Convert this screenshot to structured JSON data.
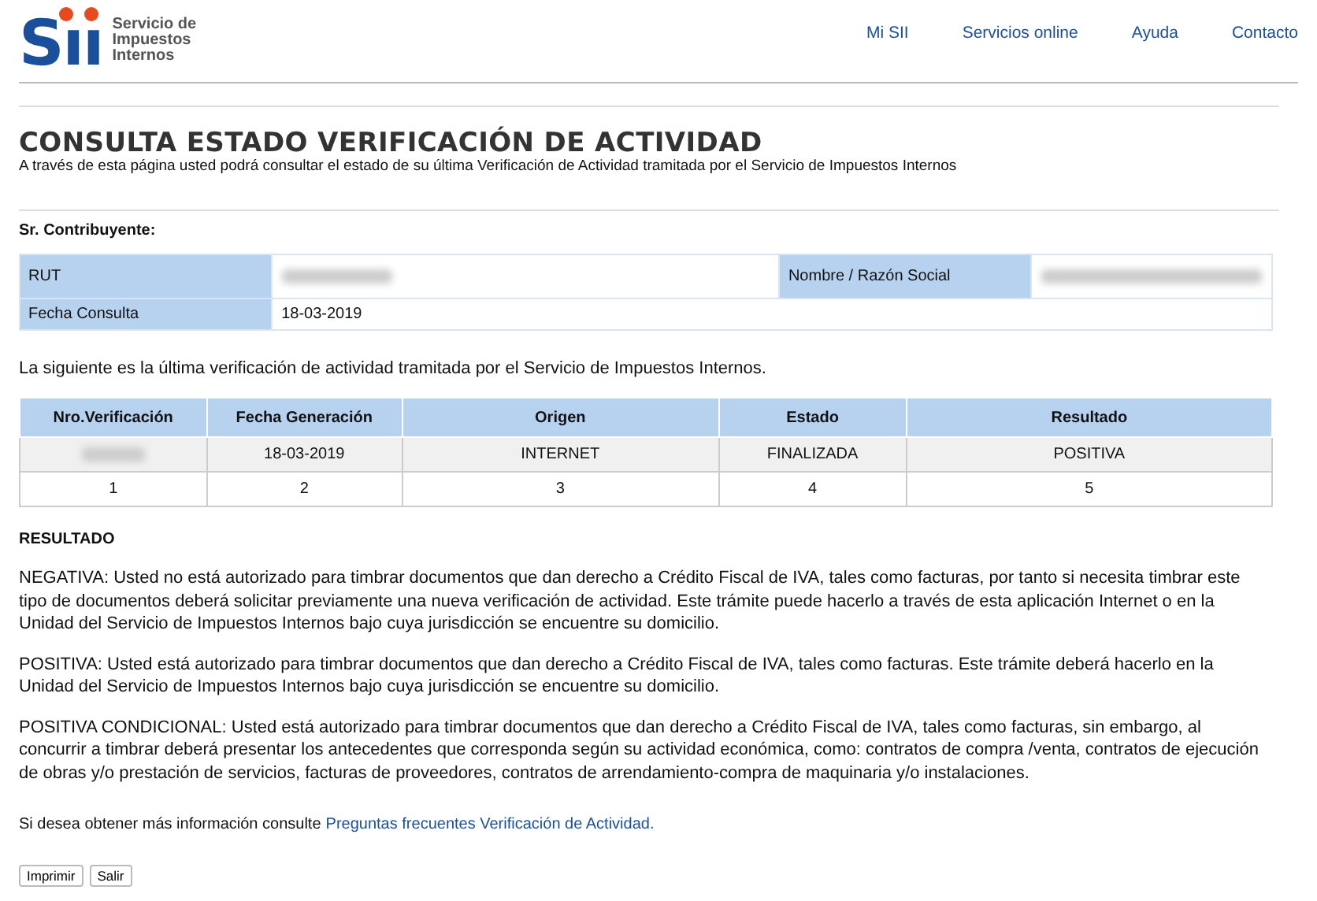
{
  "header": {
    "logo": {
      "mark": "Sıı",
      "name_lines": [
        "Servicio de",
        "Impuestos",
        "Internos"
      ]
    },
    "nav": [
      "Mi SII",
      "Servicios online",
      "Ayuda",
      "Contacto"
    ]
  },
  "title": "CONSULTA ESTADO VERIFICACIÓN DE ACTIVIDAD",
  "subtitle": "A través de esta página usted podrá consultar el estado de su última Verificación de Actividad tramitada por el Servicio de Impuestos Internos",
  "contributor": {
    "heading": "Sr. Contribuyente:",
    "rows": [
      [
        {
          "label": "RUT",
          "redacted": true
        },
        {
          "label": "Nombre / Razón Social",
          "redacted": true
        }
      ],
      [
        {
          "label": "Fecha Consulta",
          "value": "18-03-2019",
          "redacted": false
        }
      ]
    ]
  },
  "intro": "La siguiente es la última verificación de actividad tramitada por el Servicio de Impuestos Internos.",
  "table": {
    "columns": [
      "Nro.Verificación",
      "Fecha Generación",
      "Origen",
      "Estado",
      "Resultado"
    ],
    "rows": [
      [
        {
          "redacted": true
        },
        {
          "value": "18-03-2019",
          "redacted": false
        },
        {
          "value": "INTERNET",
          "redacted": false
        },
        {
          "value": "FINALIZADA",
          "redacted": false
        },
        {
          "value": "POSITIVA",
          "redacted": false
        }
      ],
      [
        {
          "value": "1",
          "redacted": false
        },
        {
          "value": "2",
          "redacted": false
        },
        {
          "value": "3",
          "redacted": false
        },
        {
          "value": "4",
          "redacted": false
        },
        {
          "value": "5",
          "redacted": false
        }
      ]
    ]
  },
  "result": {
    "heading": "RESULTADO",
    "paragraphs": [
      "NEGATIVA: Usted no está autorizado para timbrar documentos que dan derecho a Crédito Fiscal de IVA, tales como facturas, por tanto si necesita timbrar este tipo de documentos deberá solicitar previamente una nueva verificación de actividad. Este trámite puede hacerlo a través de esta aplicación Internet o en la Unidad del Servicio de Impuestos Internos bajo cuya jurisdicción se encuentre su domicilio.",
      "POSITIVA: Usted está autorizado para timbrar documentos que dan derecho a Crédito Fiscal de IVA, tales como facturas. Este trámite deberá hacerlo en la Unidad del Servicio de Impuestos Internos bajo cuya jurisdicción se encuentre su domicilio.",
      "POSITIVA CONDICIONAL: Usted está autorizado para timbrar documentos que dan derecho a Crédito Fiscal de IVA, tales como facturas, sin embargo, al concurrir a timbrar deberá presentar los antecedentes que corresponda según su actividad económica, como: contratos de compra /venta, contratos de ejecución de obras y/o prestación de servicios, facturas de proveedores, contratos de arrendamiento-compra de maquinaria y/o instalaciones."
    ]
  },
  "more_info": {
    "text": "Si desea obtener más información consulte",
    "link": "Preguntas frecuentes Verificación de Actividad."
  },
  "buttons": [
    "Imprimir",
    "Salir"
  ]
}
